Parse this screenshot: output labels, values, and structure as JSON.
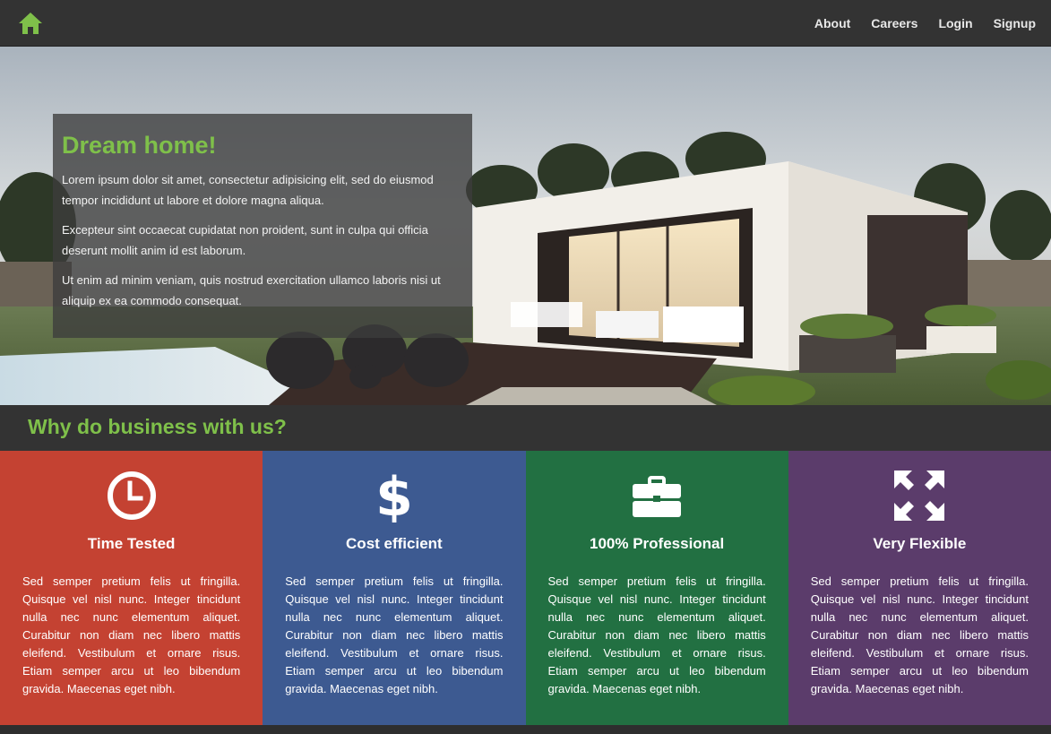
{
  "colors": {
    "accent": "#7fc04a",
    "navbar": "#333333",
    "feature_red": "#c44232",
    "feature_blue": "#3d5a91",
    "feature_green": "#227042",
    "feature_purple": "#5b3c6b"
  },
  "nav": {
    "home_icon": "home-icon",
    "links": [
      "About",
      "Careers",
      "Login",
      "Signup"
    ]
  },
  "hero": {
    "title": "Dream home!",
    "paragraphs": [
      "Lorem ipsum dolor sit amet, consectetur adipisicing elit, sed do eiusmod tempor incididunt ut labore et dolore magna aliqua.",
      "Excepteur sint occaecat cupidatat non proident, sunt in culpa qui officia deserunt mollit anim id est laborum.",
      "Ut enim ad minim veniam, quis nostrud exercitation ullamco laboris nisi ut aliquip ex ea commodo consequat."
    ]
  },
  "why": {
    "title": "Why do business with us?"
  },
  "features": [
    {
      "icon": "clock-icon",
      "title": "Time Tested",
      "text": "Sed semper pretium felis ut fringilla. Quisque vel nisl nunc. Integer tincidunt nulla nec nunc elementum aliquet. Curabitur non diam nec libero mattis eleifend. Vestibulum et ornare risus. Etiam semper arcu ut leo bibendum gravida. Maecenas eget nibh."
    },
    {
      "icon": "dollar-icon",
      "title": "Cost efficient",
      "text": "Sed semper pretium felis ut fringilla. Quisque vel nisl nunc. Integer tincidunt nulla nec nunc elementum aliquet. Curabitur non diam nec libero mattis eleifend. Vestibulum et ornare risus. Etiam semper arcu ut leo bibendum gravida. Maecenas eget nibh."
    },
    {
      "icon": "briefcase-icon",
      "title": "100% Professional",
      "text": "Sed semper pretium felis ut fringilla. Quisque vel nisl nunc. Integer tincidunt nulla nec nunc elementum aliquet. Curabitur non diam nec libero mattis eleifend. Vestibulum et ornare risus. Etiam semper arcu ut leo bibendum gravida. Maecenas eget nibh."
    },
    {
      "icon": "expand-icon",
      "title": "Very Flexible",
      "text": "Sed semper pretium felis ut fringilla. Quisque vel nisl nunc. Integer tincidunt nulla nec nunc elementum aliquet. Curabitur non diam nec libero mattis eleifend. Vestibulum et ornare risus. Etiam semper arcu ut leo bibendum gravida. Maecenas eget nibh."
    }
  ]
}
